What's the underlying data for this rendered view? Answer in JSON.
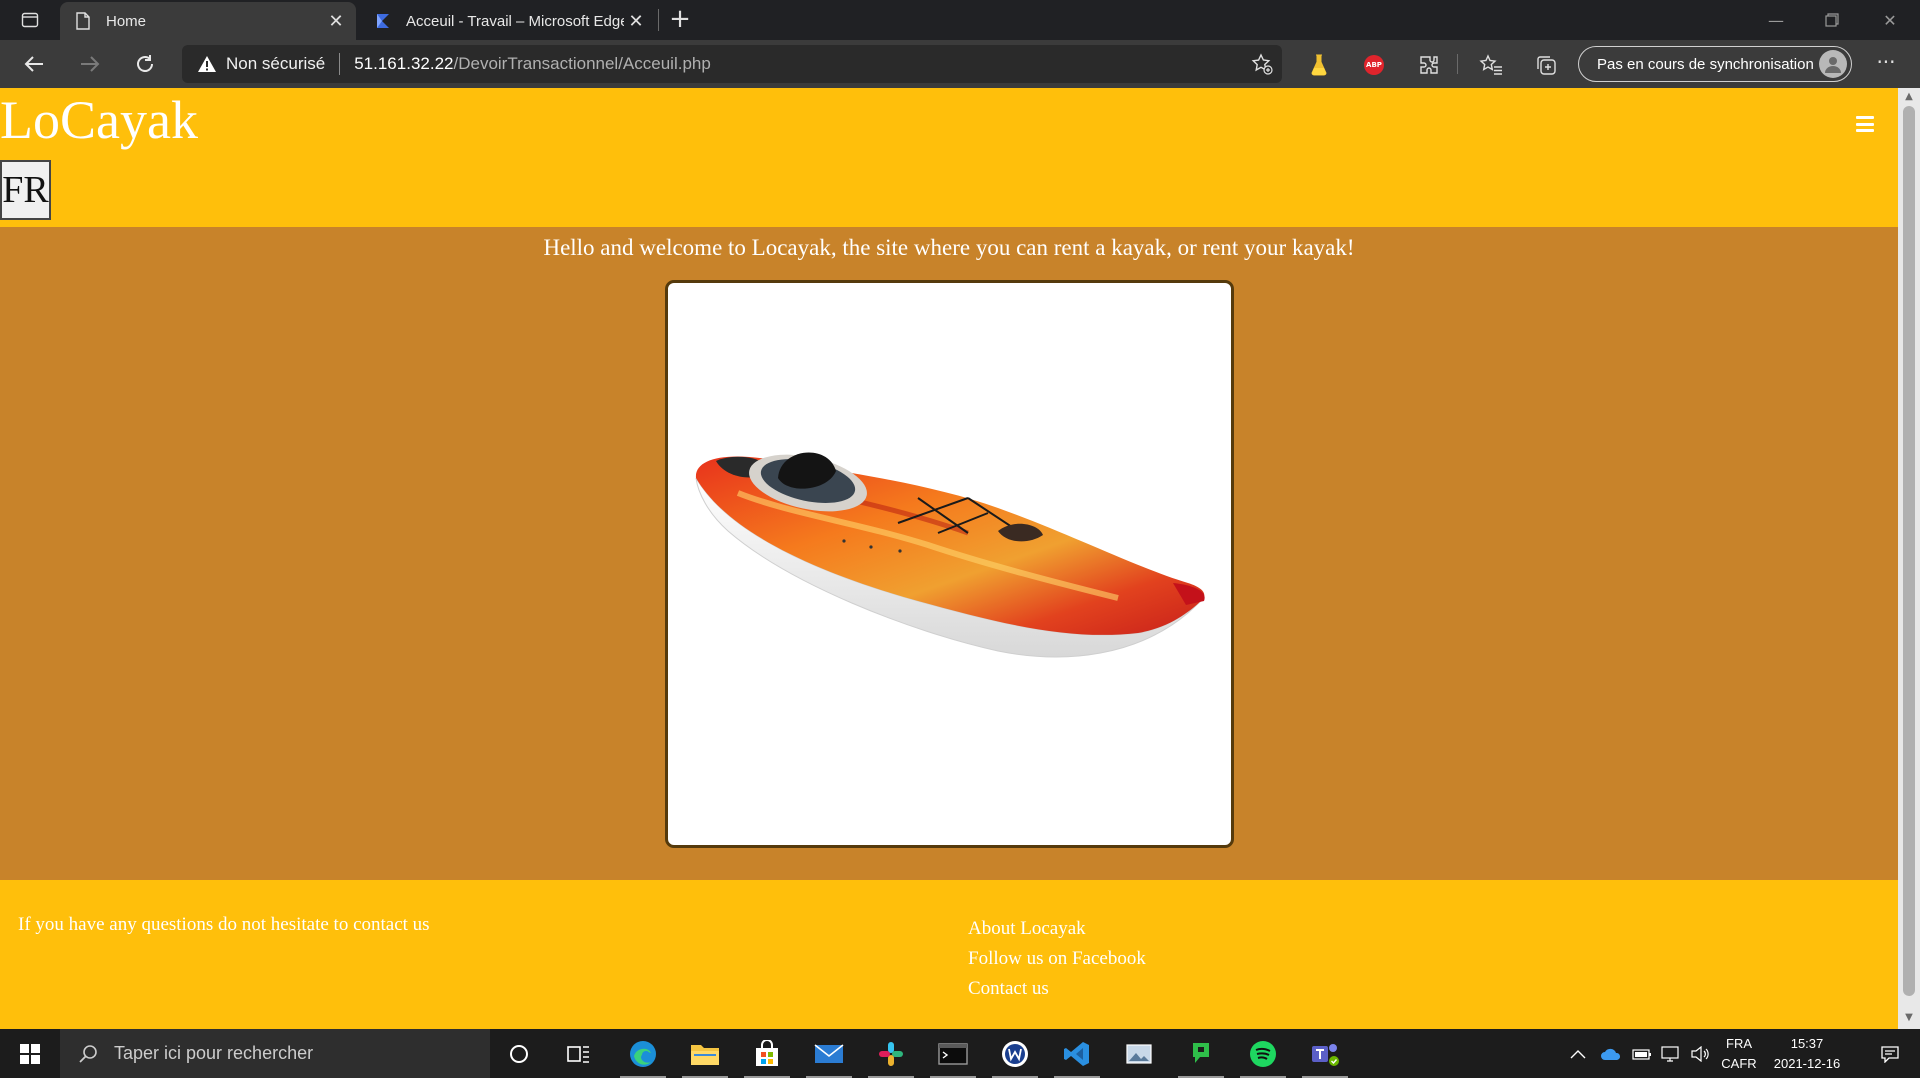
{
  "browser": {
    "tabs": [
      {
        "title": "Home",
        "active": true
      },
      {
        "title": "Acceuil - Travail – Microsoft Edge",
        "active": false
      }
    ],
    "address": {
      "security_label": "Non sécurisé",
      "host": "51.161.32.22",
      "path": "/DevoirTransactionnel/Acceuil.php"
    },
    "sync_label": "Pas en cours de synchronisation",
    "abp_label": "ABP"
  },
  "site": {
    "brand": "LoCayak",
    "language_button": "FR",
    "welcome": "Hello and welcome to Locayak, the site where you can rent a kayak, or rent your kayak!",
    "image_subject": "kayak",
    "footer": {
      "contact_text": "If you have any questions do not hesitate to contact us",
      "links": [
        "About Locayak",
        "Follow us on Facebook",
        "Contact us"
      ]
    },
    "colors": {
      "header_footer": "#ffbf0b",
      "body": "#c8832a"
    }
  },
  "taskbar": {
    "search_placeholder": "Taper ici pour rechercher",
    "apps": [
      "cortana-icon",
      "task-view-icon",
      "edge-icon",
      "file-explorer-icon",
      "store-icon",
      "mail-icon",
      "slack-icon",
      "terminal-icon",
      "word-icon",
      "vscode-icon",
      "photos-icon",
      "app-green-icon",
      "spotify-icon",
      "teams-icon"
    ],
    "language": "FRA",
    "keyboard": "CAFR",
    "time": "15:37",
    "date": "2021-12-16"
  }
}
